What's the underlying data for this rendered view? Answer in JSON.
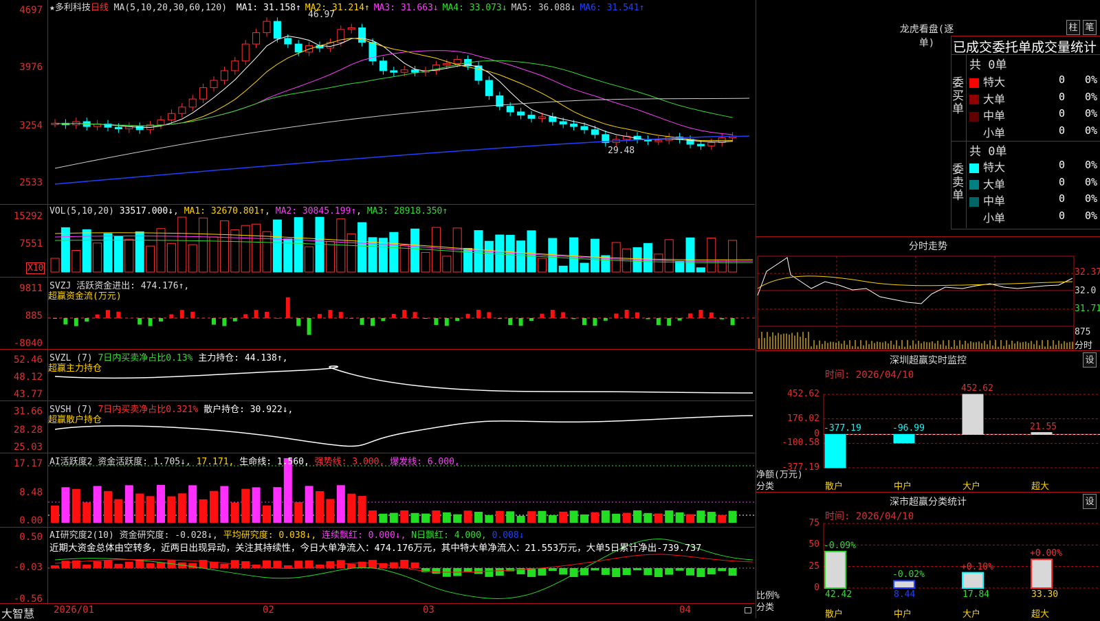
{
  "stock": {
    "name": "★多利科技",
    "period": "日线",
    "ma_header": "MA(5,10,20,30,60,120)",
    "ma_values": [
      {
        "label": "MA1: 31.158↑",
        "color": "#ffffff"
      },
      {
        "label": "MA2: 31.214↑",
        "color": "#ffd400"
      },
      {
        "label": "MA3: 31.663↓",
        "color": "#ff3cff"
      },
      {
        "label": "MA4: 33.073↓",
        "color": "#33dd33"
      },
      {
        "label": "MA5: 36.088↓",
        "color": "#cfcfcf"
      },
      {
        "label": "MA6: 31.541↑",
        "color": "#2040ff"
      }
    ],
    "high_mark": "46.97",
    "low_mark": "29.48"
  },
  "price_axis": [
    "4697",
    "3976",
    "3254",
    "2533"
  ],
  "vol": {
    "header": "VOL(5,10,20)",
    "v": "33517.000↓",
    "ma1": "MA1: 32670.801↑",
    "ma2": "MA2: 30845.199↑",
    "ma3": "MA3: 28918.350↑",
    "axis": [
      "15292",
      "7551"
    ],
    "unit": "X10"
  },
  "svzj": {
    "header": "SVZJ  活跃资金进出: 474.176↑,",
    "sub": "超赢资金流(万元)",
    "axis": [
      "9811",
      "885",
      "-8040"
    ]
  },
  "svzl": {
    "header": "SVZL (7)",
    "note": "7日内买卖净占比0.13%",
    "hold": "主力持仓: 44.138↑,",
    "sub": "超赢主力持仓",
    "axis": [
      "52.46",
      "48.12",
      "43.77"
    ]
  },
  "svsh": {
    "header": "SVSH (7)",
    "note": "7日内买卖净占比0.321%",
    "hold": "散户持仓: 30.922↓,",
    "sub": "超赢散户持仓",
    "axis": [
      "31.66",
      "28.28",
      "25.03"
    ]
  },
  "ai2": {
    "header": "AI活跃度2 资金活跃度: 1.705↓,",
    "v2": "17.171,",
    "life": "生命线: 1.560,",
    "strong": "强势线: 3.000,",
    "burst": "爆发线: 6.000,",
    "axis": [
      "17.17",
      "8.48",
      "0.00"
    ]
  },
  "ai_research": {
    "header": "AI研究度2(10) 资金研究度: -0.028↓,",
    "avg": "平均研究度: 0.038↓,",
    "red1": "连续飘红: 0.000↓,",
    "red2": "N日飘红: 4.000,",
    "v": "0.008↓",
    "comment": "近期大资金总体由空转多，近两日出现异动，关注其持续性，今日大单净流入：474.176万元，其中特大单净流入：21.553万元，大单5日累计净出-739.737",
    "axis": [
      "0.50",
      "-0.03",
      "-0.56"
    ]
  },
  "x_dates": [
    "2026/01",
    "02",
    "03",
    "04"
  ],
  "brand": "大智慧",
  "right": {
    "lhb_title": "龙虎看盘(逐单)",
    "btn1": "柱",
    "btn2": "笔",
    "order_title": "已成交委托单成交量统计",
    "buy_label": "委买单",
    "sell_label": "委卖单",
    "buy_total": "共 0单",
    "sell_total": "共 0单",
    "buy_rows": [
      {
        "name": "特大",
        "v": "0",
        "p": "0%",
        "color": "#ff0000"
      },
      {
        "name": "大单",
        "v": "0",
        "p": "0%",
        "color": "#900000"
      },
      {
        "name": "中单",
        "v": "0",
        "p": "0%",
        "color": "#600000"
      },
      {
        "name": "小单",
        "v": "0",
        "p": "0%",
        "color": "#000000"
      }
    ],
    "sell_rows": [
      {
        "name": "特大",
        "v": "0",
        "p": "0%",
        "color": "#00ffff"
      },
      {
        "name": "大单",
        "v": "0",
        "p": "0%",
        "color": "#008080"
      },
      {
        "name": "中单",
        "v": "0",
        "p": "0%",
        "color": "#006666"
      },
      {
        "name": "小单",
        "v": "0",
        "p": "0%",
        "color": "#000000"
      }
    ],
    "intraday_title": "分时走势",
    "intraday_axis": [
      "32.37",
      "32.0",
      "31.71"
    ],
    "intraday_vol": "875",
    "intraday_unit": "分时",
    "sz_title": "深圳超赢实时监控",
    "sz_btn": "设",
    "sz_time": "时间: 2026/04/10",
    "sz_axis": [
      "452.62",
      "176.02",
      "0",
      "-100.58",
      "-377.19"
    ],
    "sz_ylabel": "净额(万元)",
    "sz_xlabel": "分类",
    "sz_cats": [
      "散户",
      "中户",
      "大户",
      "超大"
    ],
    "sz_vals": [
      "-377.19",
      "-96.99",
      "452.62",
      "21.55"
    ],
    "sc_title": "深市超赢分类统计",
    "sc_btn": "设",
    "sc_time": "时间: 2026/04/10",
    "sc_axis": [
      "75",
      "50",
      "25",
      "0"
    ],
    "sc_ylabel": "比例%",
    "sc_xlabel": "分类",
    "sc_cats": [
      "散户",
      "中户",
      "大户",
      "超大"
    ],
    "sc_vals": [
      "42.42",
      "8.44",
      "17.84",
      "33.30"
    ],
    "sc_deltas": [
      "-0.09%",
      "-0.02%",
      "+0.10%",
      "+0.00%"
    ]
  },
  "chart_data": [
    {
      "type": "bar",
      "title": "深圳超赢实时监控",
      "categories": [
        "散户",
        "中户",
        "大户",
        "超大"
      ],
      "values": [
        -377.19,
        -96.99,
        452.62,
        21.55
      ],
      "ylim": [
        -377.19,
        452.62
      ],
      "ylabel": "净额(万元)"
    },
    {
      "type": "bar",
      "title": "深市超赢分类统计",
      "categories": [
        "散户",
        "中户",
        "大户",
        "超大"
      ],
      "values": [
        42.42,
        8.44,
        17.84,
        33.3
      ],
      "ylim": [
        0,
        75
      ],
      "ylabel": "比例%"
    }
  ]
}
